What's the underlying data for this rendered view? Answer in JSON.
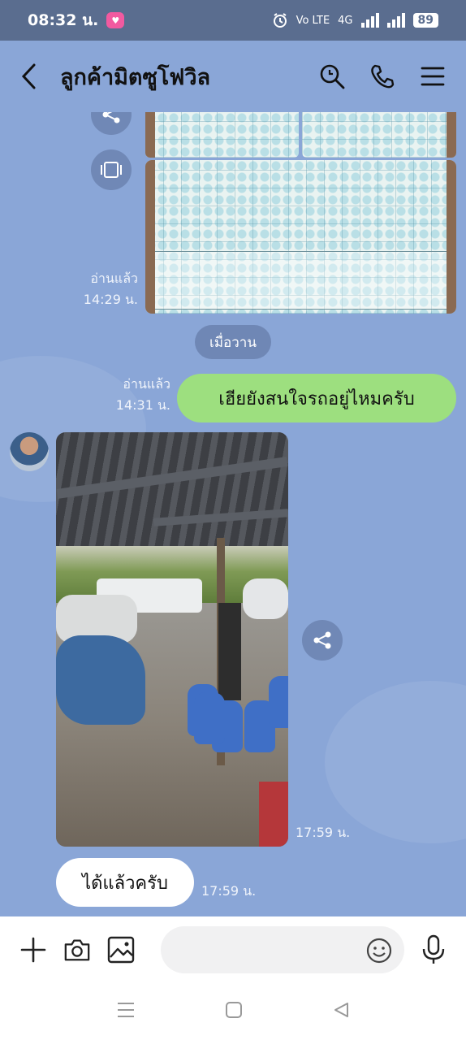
{
  "status_bar": {
    "time": "08:32 น.",
    "network_label": "Vo LTE",
    "network_type": "4G",
    "battery": "89"
  },
  "header": {
    "title": "ลูกค้ามิตซูโฟวิล"
  },
  "messages": {
    "doc_read_status": "อ่านแล้ว",
    "doc_time": "14:29 น.",
    "date_separator": "เมื่อวาน",
    "outgoing_read_status": "อ่านแล้ว",
    "outgoing_time": "14:31 น.",
    "outgoing_text": "เฮียยังสนใจรถอยู่ไหมครับ",
    "photo_time": "17:59 น.",
    "incoming_text": "ได้แล้วครับ",
    "incoming_time": "17:59 น."
  },
  "input": {
    "placeholder": ""
  },
  "icons": {
    "back": "chevron-left-icon",
    "search": "search-icon",
    "call": "phone-icon",
    "menu": "menu-icon",
    "share": "share-icon",
    "keep": "keep-icon",
    "add": "plus-icon",
    "camera": "camera-icon",
    "gallery": "image-icon",
    "emoji": "emoji-icon",
    "mic": "microphone-icon"
  },
  "colors": {
    "chat_background": "#8aa6d7",
    "outgoing_bubble": "#9ddf7f",
    "incoming_bubble": "#ffffff",
    "status_bar": "#5a6d8f"
  }
}
